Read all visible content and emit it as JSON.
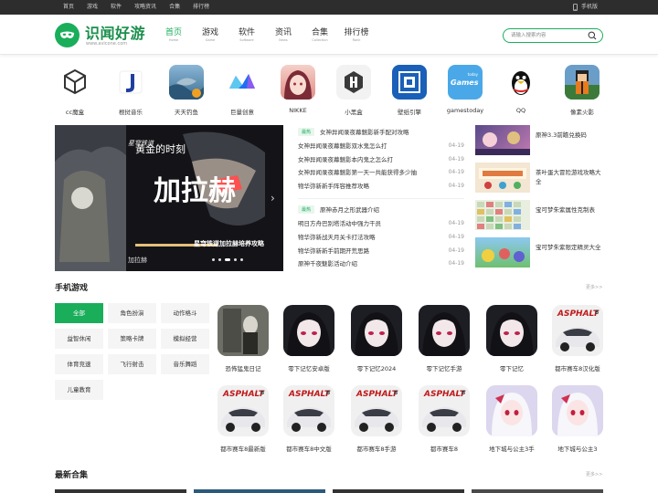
{
  "topbar": {
    "links": [
      "首页",
      "游戏",
      "软件",
      "攻略资讯",
      "合集",
      "排行榜"
    ],
    "mobile": "手机版"
  },
  "header": {
    "logo_text": "识闻好游",
    "logo_sub": "www.avicone.com",
    "nav": [
      {
        "zh": "首页",
        "en": "Home",
        "active": true
      },
      {
        "zh": "游戏",
        "en": "Game",
        "active": false
      },
      {
        "zh": "软件",
        "en": "Software",
        "active": false
      },
      {
        "zh": "资讯",
        "en": "News",
        "active": false
      },
      {
        "zh": "合集",
        "en": "Collection",
        "active": false
      },
      {
        "zh": "排行榜",
        "en": "Rank",
        "active": false
      }
    ],
    "search_placeholder": "请输入搜索内容"
  },
  "apps": [
    "cc魔盒",
    "根挝音乐",
    "天天钓鱼",
    "巨量创意",
    "NIKKE",
    "小黑盒",
    "壁纸引擎",
    "gamestoday",
    "QQ",
    "像素火影"
  ],
  "app_icon_labels": {
    "gamestoday": "Games",
    "gamestoday_small": "today"
  },
  "banner": {
    "caption": "星穹铁道加拉赫培养攻略",
    "art_title": "加拉赫",
    "art_sub": "黄金的时刻",
    "art_tag": "加拉赫",
    "art_sign": "星穹铁道"
  },
  "news": [
    {
      "tag": "最热",
      "headline": "女神异闻录夜幕魅影新手配对攻略",
      "items": [
        {
          "title": "女神异闻录夜幕魅影双水鬼怎么打",
          "date": "04-19"
        },
        {
          "title": "女神异闻录夜幕魅影本内鬼之怎么打",
          "date": "04-19"
        },
        {
          "title": "女神异闻录夜幕魅影第一天一共能获得多少抽",
          "date": "04-19"
        },
        {
          "title": "物华弥新新手阵容推荐攻略",
          "date": "04-19"
        }
      ]
    },
    {
      "tag": "最热",
      "headline": "原神赤月之形武器介绍",
      "items": [
        {
          "title": "明日方舟巴别塔活动中强力干员",
          "date": "04-19"
        },
        {
          "title": "物华弥新战天月关卡打法攻略",
          "date": "04-19"
        },
        {
          "title": "物华弥新新手前期开荒思路",
          "date": "04-19"
        },
        {
          "title": "原神千夜魅影活动介绍",
          "date": "04-19"
        }
      ]
    }
  ],
  "side_cards": [
    "原神3.3前瞻兑换码",
    "茶叶蛋大冒险游戏攻略大全",
    "宝可梦朱紫属性克制表",
    "宝可梦朱紫限定精灵大全"
  ],
  "mobile_games": {
    "title": "手机游戏",
    "more": "更多>>",
    "categories": [
      "全部",
      "角色扮演",
      "动作格斗",
      "益智休闲",
      "策略卡牌",
      "模拟经营",
      "体育竞速",
      "飞行射击",
      "音乐舞蹈",
      "儿童教育"
    ],
    "active_category": "全部",
    "games": [
      "恐怖猛鬼日记",
      "零下记忆安卓版",
      "零下记忆2024",
      "零下记忆手游",
      "零下记忆",
      "都市赛车8汉化版",
      "都市赛车8最新版",
      "都市赛车8中文版",
      "都市赛车8手游",
      "都市赛车8",
      "地下城与公主3手",
      "地下城与公主3"
    ],
    "game_icon_text": "ASPHALT",
    "game_icon_sub": "8"
  },
  "collections": {
    "title": "最新合集",
    "more": "更多>>"
  },
  "colors": {
    "brand": "#1aae5b",
    "topbar": "#2d2d2d"
  }
}
